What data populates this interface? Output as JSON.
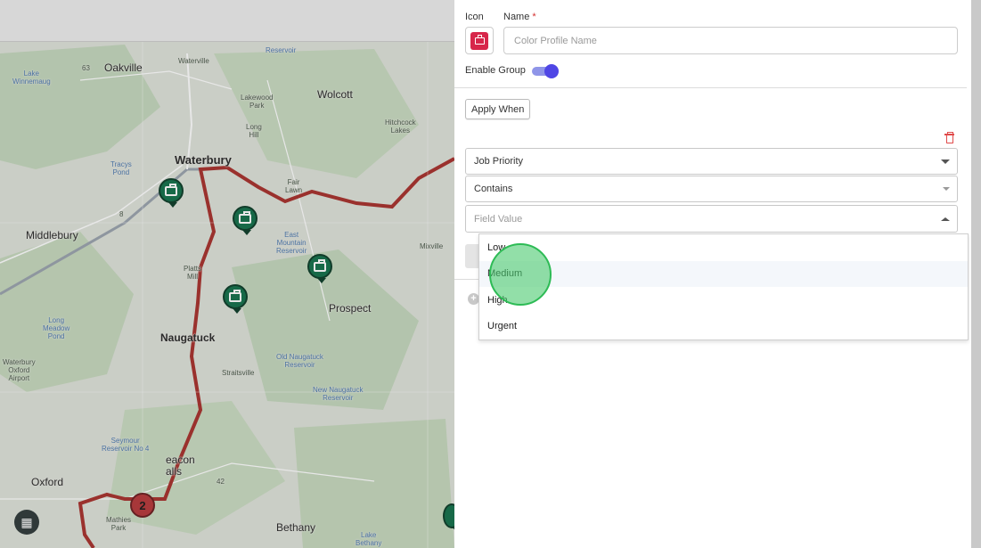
{
  "map": {
    "labels": {
      "oakville": "Oakville",
      "waterville": "Waterville",
      "wolcott": "Wolcott",
      "waterbury": "Waterbury",
      "middlebury": "Middlebury",
      "naugatuck": "Naugatuck",
      "prospect": "Prospect",
      "mixville": "Mixville",
      "oxford": "Oxford",
      "bethany": "Bethany",
      "straitsville": "Straitsville",
      "long_hill": "Long\nHill",
      "fair_lawn": "Fair\nLawn",
      "platts_mill": "Platts\nMill",
      "beacon_falls": "eacon\nalls",
      "hitchcock_lakes": "Hitchcock\nLakes",
      "lakewood_park": "Lakewood\nPark",
      "oxford_airport": "Waterbury\nOxford\nAirport",
      "lake_winnemaug": "Lake\nWinnemaug",
      "long_meadow_pond": "Long\nMeadow\nPond",
      "old_naugatuck_reservoir": "Old Naugatuck\nReservoir",
      "new_naugatuck_reservoir": "New Naugatuck\nReservoir",
      "seymour_reservoir": "Seymour\nReservoir No 4",
      "east_mountain_reservoir": "East\nMountain\nReservoir",
      "tracys_pond": "Tracys\nPond",
      "mathies_park": "Mathies\nPark",
      "lake_bethany": "Lake\nBethany",
      "reservoir_top": "Reservoir",
      "route_63": "63",
      "route_42": "42",
      "route_8": "8"
    },
    "cluster_count": "2",
    "pins": [
      "job-pin",
      "job-pin",
      "job-pin",
      "job-pin"
    ],
    "colors": {
      "pin": "#13704a",
      "cluster": "#b7373a",
      "route": "#a8302c"
    }
  },
  "form": {
    "icon_label": "Icon",
    "icon_name": "briefcase-icon",
    "icon_color": "#d7264a",
    "name_label": "Name",
    "required_mark": "*",
    "name_placeholder": "Color Profile Name",
    "name_value": "",
    "enable_group_label": "Enable Group",
    "enable_group_on": true,
    "apply_when_label": "Apply When",
    "condition": {
      "field": "Job Priority",
      "operator": "Contains",
      "value_placeholder": "Field Value"
    },
    "options": [
      "Low",
      "Medium",
      "High",
      "Urgent"
    ],
    "hovered_option": "Medium"
  }
}
